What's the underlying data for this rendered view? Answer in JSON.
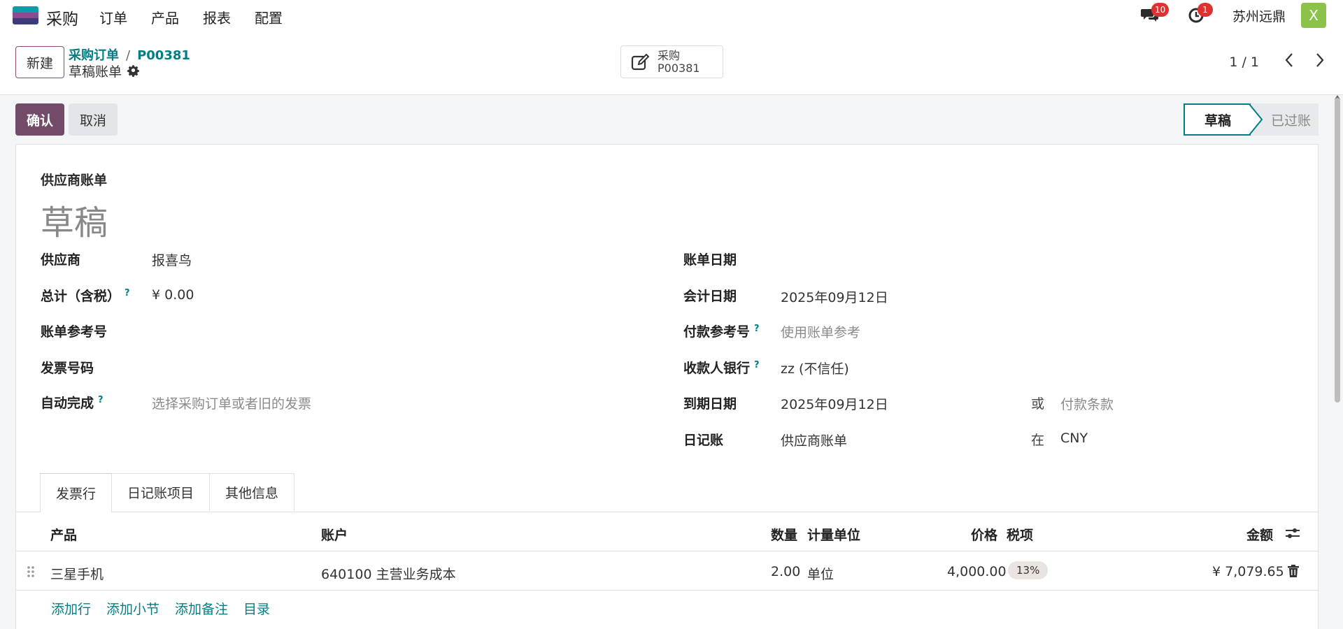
{
  "navbar": {
    "app_name": "采购",
    "menu": [
      "订单",
      "产品",
      "报表",
      "配置"
    ],
    "messages_count": "10",
    "activities_count": "1",
    "company": "苏州远鼎",
    "avatar_letter": "X"
  },
  "control_panel": {
    "new_label": "新建",
    "breadcrumb_parent": "采购订单",
    "breadcrumb_sep": "/",
    "breadcrumb_current": "P00381",
    "record_title": "草稿账单",
    "smart_button_line1": "采购",
    "smart_button_line2": "P00381",
    "pager": "1 / 1"
  },
  "actions": {
    "confirm_label": "确认",
    "cancel_label": "取消"
  },
  "status": {
    "stages": [
      "草稿",
      "已过账"
    ],
    "current": "草稿"
  },
  "form": {
    "doc_type": "供应商账单",
    "doc_name": "草稿",
    "left": {
      "vendor_label": "供应商",
      "vendor_value": "报喜鸟",
      "total_label": "总计（含税）",
      "total_value": "¥ 0.00",
      "bill_ref_label": "账单参考号",
      "invoice_no_label": "发票号码",
      "autocomplete_label": "自动完成",
      "autocomplete_placeholder": "选择采购订单或者旧的发票"
    },
    "right": {
      "bill_date_label": "账单日期",
      "accounting_date_label": "会计日期",
      "accounting_date_value": "2025年09月12日",
      "payment_ref_label": "付款参考号",
      "payment_ref_placeholder": "使用账单参考",
      "bank_label": "收款人银行",
      "bank_value": "zz (不信任)",
      "due_date_label": "到期日期",
      "due_date_value": "2025年09月12日",
      "or_label": "或",
      "payment_terms_placeholder": "付款条款",
      "journal_label": "日记账",
      "journal_value": "供应商账单",
      "in_label": "在",
      "currency_value": "CNY"
    },
    "help_mark": "?"
  },
  "tabs": [
    "发票行",
    "日记账项目",
    "其他信息"
  ],
  "table": {
    "headers": {
      "product": "产品",
      "account": "账户",
      "quantity": "数量",
      "uom": "计量单位",
      "price": "价格",
      "taxes": "税项",
      "amount": "金额"
    },
    "rows": [
      {
        "product": "三星手机",
        "account": "640100 主营业务成本",
        "quantity": "2.00",
        "uom": "单位",
        "price": "4,000.00",
        "tax": "13%",
        "amount": "¥ 7,079.65"
      }
    ],
    "add_links": [
      "添加行",
      "添加小节",
      "添加备注",
      "目录"
    ]
  },
  "colors": {
    "primary": "#714b67",
    "teal": "#017e84",
    "badge": "#e03131"
  }
}
